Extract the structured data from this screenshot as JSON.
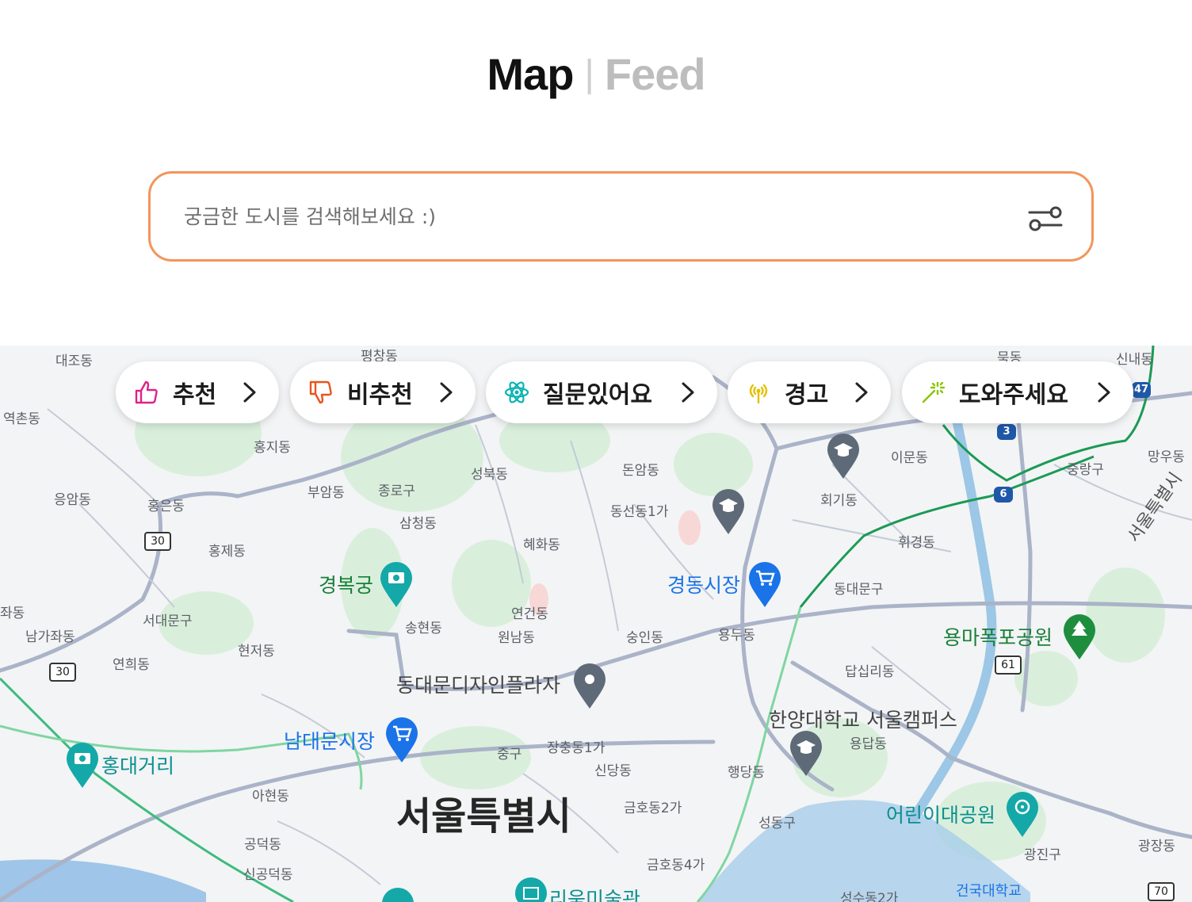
{
  "header": {
    "tab_map": "Map",
    "separator": "|",
    "tab_feed": "Feed"
  },
  "search": {
    "placeholder": "궁금한 도시를 검색해보세요 :)",
    "value": ""
  },
  "icons": {
    "filter": "sliders-icon",
    "chevron": "chevron-right-icon"
  },
  "colors": {
    "accent_border": "#f3955a",
    "active_tab": "#111111",
    "inactive_tab": "#bdbdbd"
  },
  "chips": [
    {
      "label": "추천",
      "icon": "thumbs-up-icon",
      "color": "#e0218a"
    },
    {
      "label": "비추천",
      "icon": "thumbs-down-icon",
      "color": "#e8551c"
    },
    {
      "label": "질문있어요",
      "icon": "atom-icon",
      "color": "#0bb3b3"
    },
    {
      "label": "경고",
      "icon": "broadcast-icon",
      "color": "#e4c000"
    },
    {
      "label": "도와주세요",
      "icon": "magic-wand-icon",
      "color": "#8bc400"
    }
  ],
  "map": {
    "city": "서울특별시",
    "pois": {
      "gyeongbokgung": "경복궁",
      "gyeongdong_market": "경동시장",
      "ddp": "동대문디자인플라자",
      "namdaemun_market": "남대문시장",
      "hongdae": "홍대거리",
      "hanyang_univ": "한양대학교 서울캠퍼스",
      "yongma_park": "용마폭포공원",
      "childrens_park": "어린이대공원",
      "konkuk_univ": "건국대학교",
      "leeum": "리움미술관"
    },
    "districts": {
      "daejo": "대조동",
      "pyeongchang": "평창동",
      "yeokchon": "역촌동",
      "hongji": "홍지동",
      "eungam": "응암동",
      "hongeun": "홍은동",
      "buam": "부암동",
      "jongno": "종로구",
      "seongbuk": "성북동",
      "donam": "돈암동",
      "imun": "이문동",
      "mangu": "망우동",
      "jungnang": "중랑구",
      "hoegi": "회기동",
      "dongseon": "동선동1가",
      "samcheong": "삼청동",
      "hyehwa": "혜화동",
      "hongje": "홍제동",
      "hwigyeong": "휘경동",
      "dongdaemun": "동대문구",
      "seodaemun": "서대문구",
      "namgajwa": "남가좌동",
      "jwa": "좌동",
      "yeonhui": "연희동",
      "hyeonjeo": "현저동",
      "songhyeon": "송현동",
      "yeongeon": "연건동",
      "wonnam": "원남동",
      "sungin": "숭인동",
      "yongdu": "용두동",
      "dapsimni": "답십리동",
      "junggu": "중구",
      "jangchung": "장충동1가",
      "sindang": "신당동",
      "haengdang": "행당동",
      "yongdap": "용답동",
      "ahyeon": "아현동",
      "geumho2": "금호동2가",
      "seongdong": "성동구",
      "gongdeok": "공덕동",
      "singongdeok": "신공덕동",
      "geumho4": "금호동4가",
      "gwangjin": "광진구",
      "gwangjang": "광장동",
      "seongsu2": "성수동2가",
      "seoul_side": "서울특별시",
      "mukdong": "묵동",
      "sinnae": "신내동"
    },
    "road_numbers": {
      "r30a": "30",
      "r30b": "30",
      "r61": "61",
      "r70": "70"
    },
    "metro_numbers": {
      "m3": "3",
      "m6": "6",
      "m47": "47"
    }
  }
}
